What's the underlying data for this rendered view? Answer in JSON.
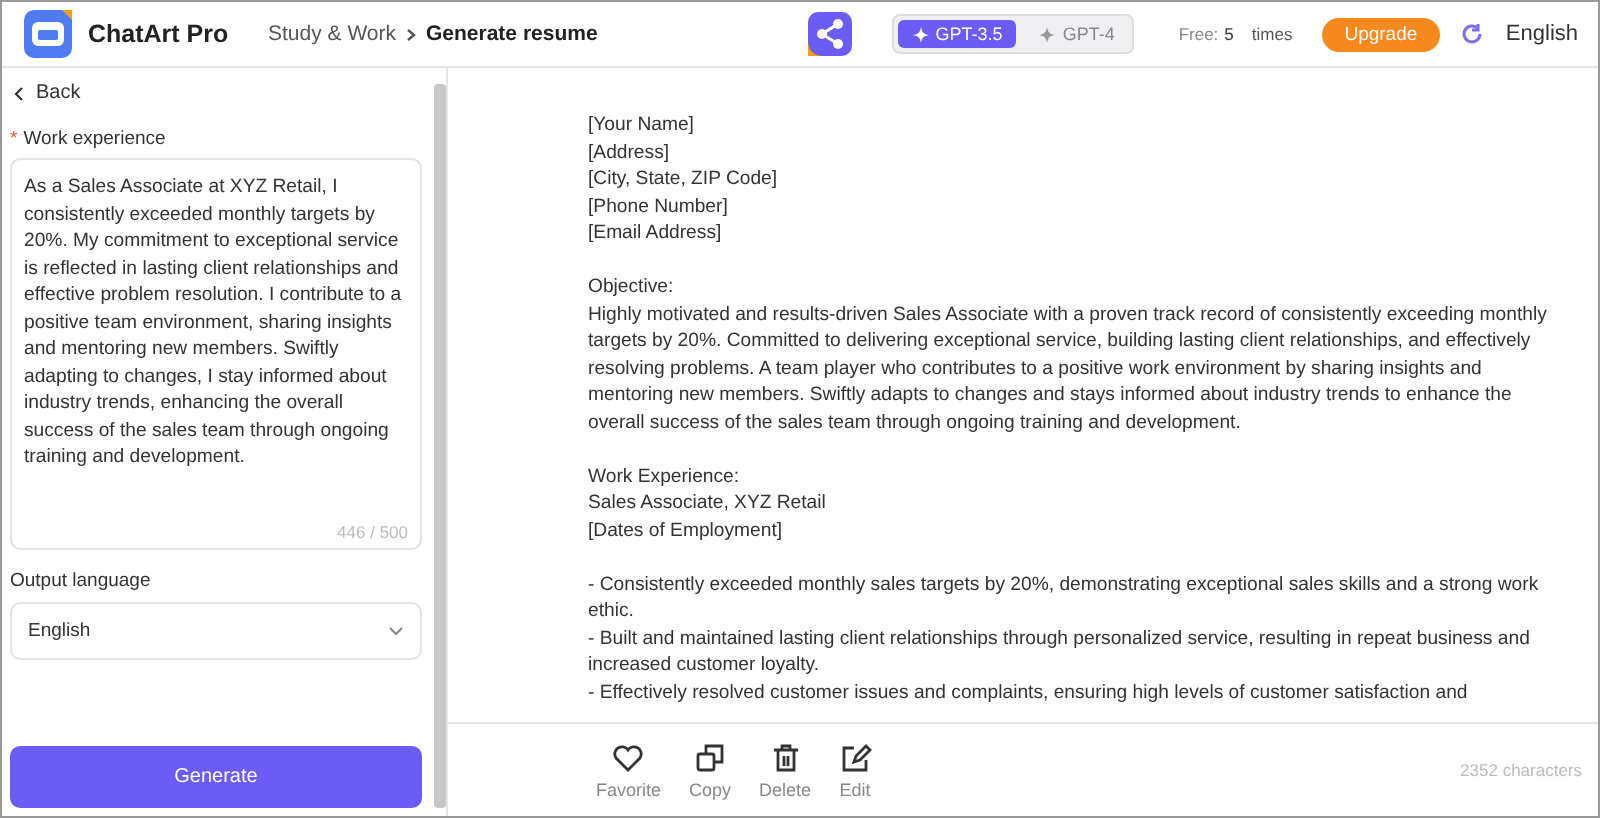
{
  "header": {
    "app_name": "ChatArt Pro",
    "breadcrumb": "Study & Work",
    "breadcrumb_current": "Generate resume",
    "models": [
      {
        "label": "GPT-3.5",
        "selected": true
      },
      {
        "label": "GPT-4",
        "selected": false
      }
    ],
    "free_label": "Free:",
    "free_count": "5",
    "free_unit": "times",
    "upgrade": "Upgrade",
    "language": "English"
  },
  "sidebar": {
    "back": "Back",
    "field_label": "Work experience",
    "required_mark": "*",
    "field_value": "As a Sales Associate at XYZ Retail, I consistently exceeded monthly targets by 20%. My commitment to exceptional service is reflected in lasting client relationships and effective problem resolution. I contribute to a positive team environment, sharing insights and mentoring new members. Swiftly adapting to changes, I stay informed about industry trends, enhancing the overall success of the sales team through ongoing training and development.",
    "counter": "446 / 500",
    "language_label": "Output language",
    "language_value": "English",
    "generate": "Generate"
  },
  "document": {
    "paragraphs": [
      [
        "[Your Name]",
        "[Address]",
        "[City, State, ZIP Code]",
        "[Phone Number]",
        "[Email Address]"
      ],
      [
        "Objective:",
        "Highly motivated and results-driven Sales Associate with a proven track record of consistently exceeding monthly targets by 20%. Committed to delivering exceptional service, building lasting client relationships, and effectively resolving problems. A team player who contributes to a positive work environment by sharing insights and mentoring new members. Swiftly adapts to changes and stays informed about industry trends to enhance the overall success of the sales team through ongoing training and development."
      ],
      [
        "Work Experience:",
        "Sales Associate, XYZ Retail",
        "[Dates of Employment]"
      ],
      [
        "- Consistently exceeded monthly sales targets by 20%, demonstrating exceptional sales skills and a strong work ethic.",
        "- Built and maintained lasting client relationships through personalized service, resulting in repeat business and increased customer loyalty.",
        "- Effectively resolved customer issues and complaints, ensuring high levels of customer satisfaction and"
      ]
    ]
  },
  "actions": [
    {
      "kind": "favorite",
      "label": "Favorite"
    },
    {
      "kind": "copy",
      "label": "Copy"
    },
    {
      "kind": "delete",
      "label": "Delete"
    },
    {
      "kind": "edit",
      "label": "Edit"
    }
  ],
  "char_count": "2352 characters"
}
